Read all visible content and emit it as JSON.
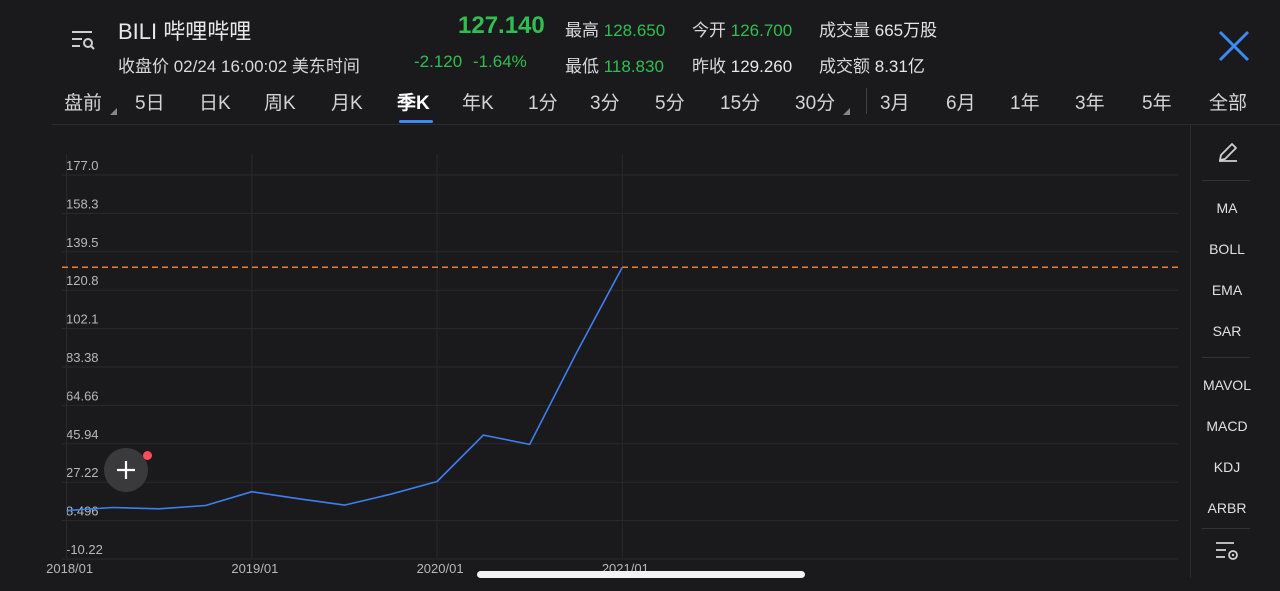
{
  "header": {
    "ticker": "BILI",
    "name": "哔哩哔哩",
    "price": "127.140",
    "close_info": "收盘价 02/24 16:00:02 美东时间",
    "change": "-2.120",
    "change_pct": "-1.64%",
    "stats": {
      "high_label": "最高",
      "high_value": "128.650",
      "open_label": "今开",
      "open_value": "126.700",
      "volume_label": "成交量",
      "volume_value": "665万股",
      "low_label": "最低",
      "low_value": "118.830",
      "prev_close_label": "昨收",
      "prev_close_value": "129.260",
      "turnover_label": "成交额",
      "turnover_value": "8.31亿"
    }
  },
  "tabs": [
    "盘前",
    "5日",
    "日K",
    "周K",
    "月K",
    "季K",
    "年K",
    "1分",
    "3分",
    "5分",
    "15分",
    "30分",
    "3月",
    "6月",
    "1年",
    "3年",
    "5年",
    "全部"
  ],
  "active_tab": "季K",
  "side_panel": {
    "indicators_main": [
      "MA",
      "BOLL",
      "EMA",
      "SAR"
    ],
    "indicators_sub": [
      "MAVOL",
      "MACD",
      "KDJ",
      "ARBR"
    ]
  },
  "colors": {
    "price_up": "#e0463b",
    "price_down": "#2fbf50",
    "line": "#3d7ff0",
    "ref_line": "#f07d2f",
    "accent": "#3d8af7"
  },
  "chart_data": {
    "type": "line",
    "title": "",
    "xlabel": "",
    "ylabel": "",
    "y_ticks": [
      "177.0",
      "158.3",
      "139.5",
      "120.8",
      "102.1",
      "83.38",
      "64.66",
      "45.94",
      "27.22",
      "8.496",
      "-10.22"
    ],
    "x_ticks": [
      "2018/01",
      "2019/01",
      "2020/01",
      "2021/01"
    ],
    "ylim": [
      -10.22,
      177.0
    ],
    "x_range_quarters": [
      -0.1,
      24
    ],
    "grid": true,
    "reference_line": 127.14,
    "series": [
      {
        "quarters": [
          0,
          1,
          2,
          3,
          4,
          5,
          6,
          7,
          8,
          9,
          10,
          11,
          12
        ],
        "values": [
          8.5,
          10.0,
          9.4,
          11.0,
          17.7,
          14.3,
          11.2,
          16.5,
          22.7,
          45.3,
          40.8,
          85.0,
          127.14
        ]
      }
    ]
  }
}
